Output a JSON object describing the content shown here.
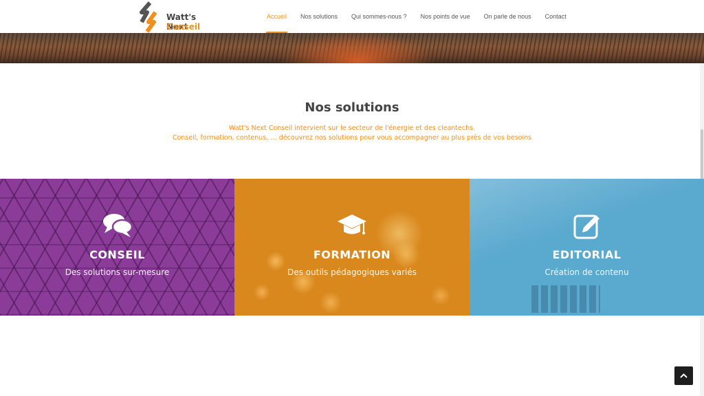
{
  "brand": {
    "name": "Watt's Next",
    "sub": "Conseil",
    "accent": "#f0901e"
  },
  "nav": {
    "items": [
      {
        "label": "Accueil",
        "active": true
      },
      {
        "label": "Nos solutions"
      },
      {
        "label": "Qui sommes-nous ?"
      },
      {
        "label": "Nos points de vue"
      },
      {
        "label": "On parle de nous"
      },
      {
        "label": "Contact"
      }
    ]
  },
  "main": {
    "title": "Nos solutions",
    "intro_line1": "Watt's Next Conseil intervient sur le secteur de l'énergie et des cleantechs.",
    "intro_line2": "Conseil, formation, contenus, … découvrez nos solutions pour vous accompagner au plus près de vos besoins"
  },
  "panels": [
    {
      "title": "CONSEIL",
      "subtitle": "Des solutions sur-mesure",
      "icon": "chat-bubbles-icon",
      "color": "#8a3c98"
    },
    {
      "title": "FORMATION",
      "subtitle": "Des outils pédagogiques variés",
      "icon": "graduation-cap-icon",
      "color": "#d9881e"
    },
    {
      "title": "EDITORIAL",
      "subtitle": "Création de contenu",
      "icon": "edit-icon",
      "color": "#5aa9cf"
    }
  ],
  "back_to_top": {
    "icon": "chevron-up-icon"
  }
}
